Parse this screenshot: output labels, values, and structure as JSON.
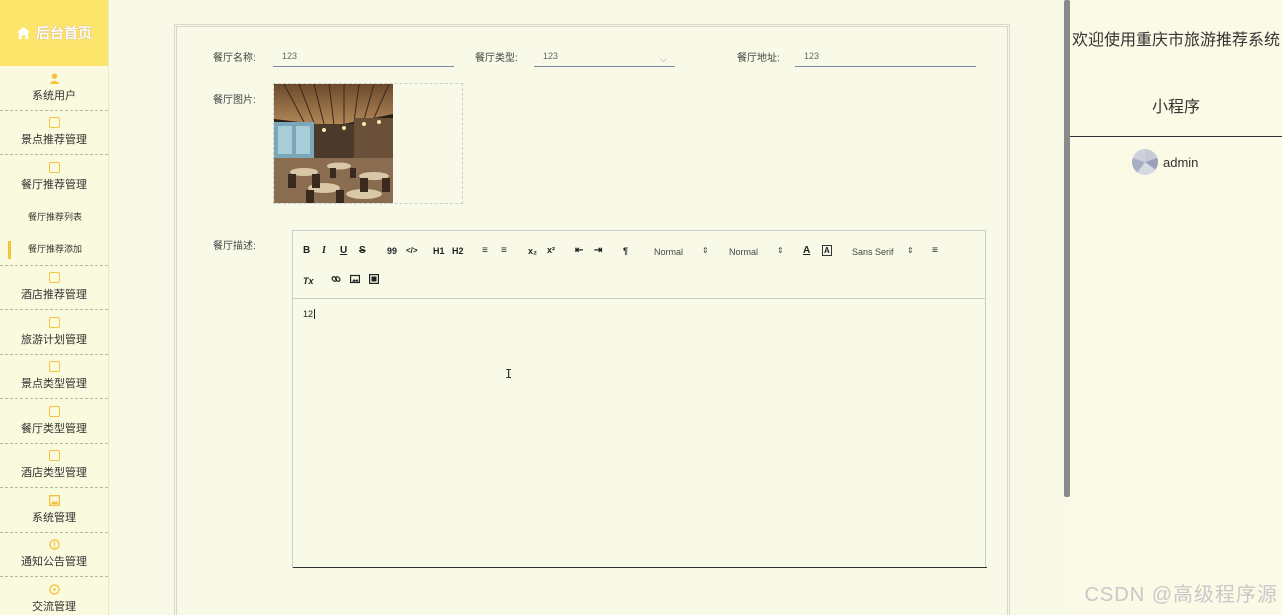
{
  "sidebar": {
    "home": "后台首页",
    "items": [
      {
        "label": "系统用户",
        "icon": "user-icon"
      },
      {
        "label": "景点推荐管理",
        "icon": "edit-icon"
      },
      {
        "label": "餐厅推荐管理",
        "icon": "edit-icon"
      }
    ],
    "subs": [
      {
        "label": "餐厅推荐列表"
      },
      {
        "label": "餐厅推荐添加"
      }
    ],
    "items2": [
      {
        "label": "酒店推荐管理",
        "icon": "edit-icon"
      },
      {
        "label": "旅游计划管理",
        "icon": "edit-icon"
      },
      {
        "label": "景点类型管理",
        "icon": "edit-icon"
      },
      {
        "label": "餐厅类型管理",
        "icon": "edit-icon"
      },
      {
        "label": "酒店类型管理",
        "icon": "edit-icon"
      },
      {
        "label": "系统管理",
        "icon": "image-icon"
      },
      {
        "label": "通知公告管理",
        "icon": "info-icon"
      },
      {
        "label": "交流管理",
        "icon": "chat-icon"
      }
    ]
  },
  "form": {
    "name_label": "餐厅名称:",
    "name_value": "123",
    "type_label": "餐厅类型:",
    "type_value": "123",
    "address_label": "餐厅地址:",
    "address_value": "123",
    "image_label": "餐厅图片:",
    "desc_label": "餐厅描述:"
  },
  "editor": {
    "toolbar": {
      "bold": "B",
      "italic": "I",
      "underline": "U",
      "strike": "S",
      "quote": "99",
      "code": "</>",
      "h1": "H1",
      "h2": "H2",
      "ordered": "≡",
      "bullet": "≡",
      "sub": "x₂",
      "sup": "x²",
      "outdent": "⇤",
      "indent": "⇥",
      "direction": "¶",
      "size": "Normal",
      "header": "Normal",
      "color": "A",
      "background": "A",
      "font": "Sans Serif",
      "align": "≡",
      "clean": "Tx",
      "link": "🔗",
      "image": "▣",
      "video": "▤"
    },
    "content": "12"
  },
  "header": {
    "title_line1": "欢迎使用重庆市旅游推荐系统",
    "title_line2": "小程序",
    "username": "admin"
  },
  "watermark": "CSDN @高级程序源"
}
